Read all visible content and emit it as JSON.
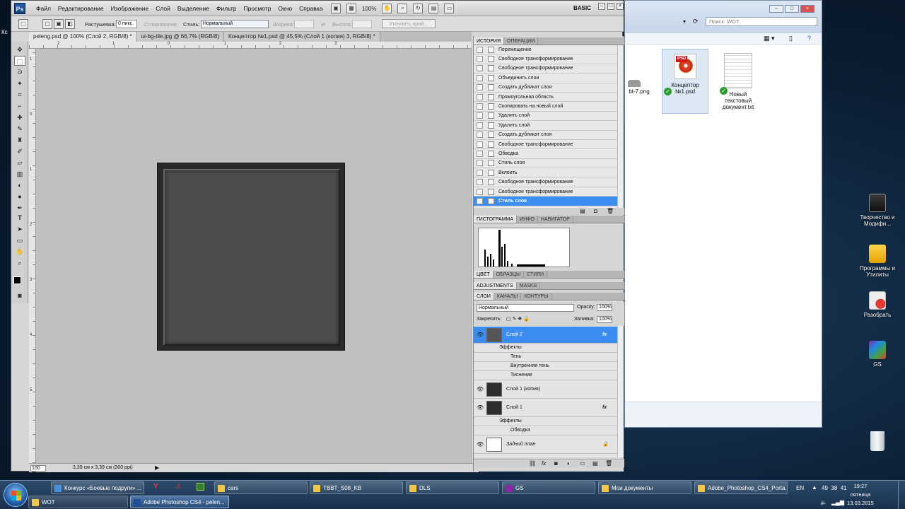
{
  "ps": {
    "logo": "Ps",
    "menu": [
      "Файл",
      "Редактирование",
      "Изображение",
      "Слой",
      "Выделение",
      "Фильтр",
      "Просмотр",
      "Окно",
      "Справка"
    ],
    "zoom": "100%",
    "workspace": "BASIC",
    "options": {
      "feather_label": "Растушевка:",
      "feather_value": "0 пикс.",
      "antialias_label": "Сглаживание",
      "style_label": "Стиль:",
      "style_value": "Нормальный",
      "width_label": "Ширина:",
      "height_label": "Высота:",
      "refine_label": "Уточнить край..."
    },
    "tabs": [
      "peleng.psd @ 100% (Слой 2, RGB/8) *",
      "ui-bg-tile.jpg @ 66,7% (RGB/8)",
      "Концептор №1.psd @ 45,5% (Слой 1 (копия) 3, RGB/8) *"
    ],
    "status": {
      "zoom": "100 %",
      "size": "3,39 см x 3,39 см (300 ppi)"
    },
    "ruler_top": [
      "2",
      "1",
      "0",
      "1",
      "2",
      "3"
    ],
    "ruler_left": [
      "1",
      "0",
      "1",
      "2",
      "3",
      "4",
      "5"
    ]
  },
  "history": {
    "tabs": [
      "ИСТОРИЯ",
      "ОПЕРАЦИИ"
    ],
    "items": [
      "Перемещение",
      "Свободное трансформирование",
      "Свободное трансформирование",
      "Объединить слои",
      "Создать дубликат слоя",
      "Прямоугольная область",
      "Скопировать на новый слой",
      "Удалить слой",
      "Удалить слой",
      "Создать дубликат слоя",
      "Свободное трансформирование",
      "Обводка",
      "Стиль слоя",
      "Вклеить",
      "Свободное трансформирование",
      "Свободное трансформирование",
      "Стиль слоя"
    ],
    "selected_index": 16
  },
  "histogram": {
    "tabs": [
      "ГИСТОГРАММА",
      "ИНФО",
      "НАВИГАТОР"
    ]
  },
  "color_tabs": [
    "ЦВЕТ",
    "ОБРАЗЦЫ",
    "СТИЛИ"
  ],
  "adjust_tabs": [
    "ADJUSTMENTS",
    "MASKS"
  ],
  "layers_panel": {
    "tabs": [
      "СЛОИ",
      "КАНАЛЫ",
      "КОНТУРЫ"
    ],
    "blend_mode": "Нормальный",
    "opacity_label": "Opacity:",
    "opacity": "100%",
    "lock_label": "Закрепить:",
    "fill_label": "Заливка:",
    "fill": "100%",
    "fx": "fx",
    "layer2": "Слой 2",
    "effects": "Эффекты",
    "shadow": "Тень",
    "inner_shadow": "Внутренняя тень",
    "emboss": "Тиснение",
    "layer1_copy": "Слой 1 (копия)",
    "layer1": "Слой 1",
    "effects2": "Эффекты",
    "stroke": "Обводка",
    "background": "Задний план"
  },
  "explorer": {
    "search_placeholder": "Поиск: WOT",
    "partial_file": "bt-7.png",
    "psd_file": "Концептор №1.psd",
    "txt_file": "Новый текстовый документ.txt"
  },
  "desktop": {
    "icons": [
      "Творчество и Модифи...",
      "Программы и Утилиты",
      "Разобрать",
      "GS"
    ],
    "left_fragment": "Кс"
  },
  "taskbar": {
    "row1": [
      "Конкурс «Боевые подруги» ...",
      "cars",
      "TBBT_S08_KB",
      "DLS",
      "GS",
      "Мои документы",
      "Adobe_Photoshop_CS4_Porta..."
    ],
    "row2": [
      "WOT",
      "Adobe Photoshop CS4 - pelen..."
    ],
    "lang": "EN",
    "tray_nums": "49  38  41",
    "time": "19:27",
    "day": "пятница",
    "date": "13.03.2015"
  }
}
